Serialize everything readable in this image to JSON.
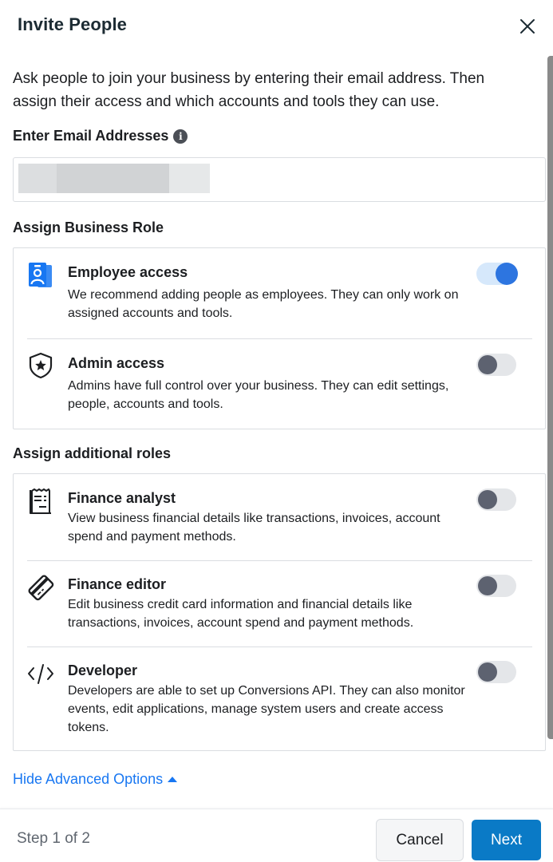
{
  "dialog": {
    "title": "Invite People",
    "close_icon": "close-icon"
  },
  "intro": "Ask people to join your business by entering their email address. Then assign their access and which accounts and tools they can use.",
  "email": {
    "label": "Enter Email Addresses",
    "info_icon_glyph": "i",
    "value": "",
    "value_redacted": true
  },
  "business_role": {
    "title": "Assign Business Role",
    "roles": [
      {
        "icon": "employee-badge-icon",
        "title": "Employee access",
        "description": "We recommend adding people as employees. They can only work on assigned accounts and tools.",
        "enabled": true
      },
      {
        "icon": "admin-shield-icon",
        "title": "Admin access",
        "description": "Admins have full control over your business. They can edit settings, people, accounts and tools.",
        "enabled": false
      }
    ]
  },
  "additional_roles": {
    "title": "Assign additional roles",
    "roles": [
      {
        "icon": "receipt-icon",
        "title": "Finance analyst",
        "description": "View business financial details like transactions, invoices, account spend and payment methods.",
        "enabled": false
      },
      {
        "icon": "credit-card-icon",
        "title": "Finance editor",
        "description": "Edit business credit card information and financial details like transactions, invoices, account spend and payment methods.",
        "enabled": false
      },
      {
        "icon": "code-icon",
        "title": "Developer",
        "description": "Developers are able to set up Conversions API. They can also monitor events, edit applications, manage system users and create access tokens.",
        "enabled": false
      }
    ]
  },
  "advanced_link": "Hide Advanced Options",
  "footer": {
    "step": "Step 1 of 2",
    "cancel_label": "Cancel",
    "next_label": "Next"
  },
  "colors": {
    "accent": "#1877f2",
    "toggle_on": "#2d75e0",
    "primary_button": "#0a7ac6"
  }
}
